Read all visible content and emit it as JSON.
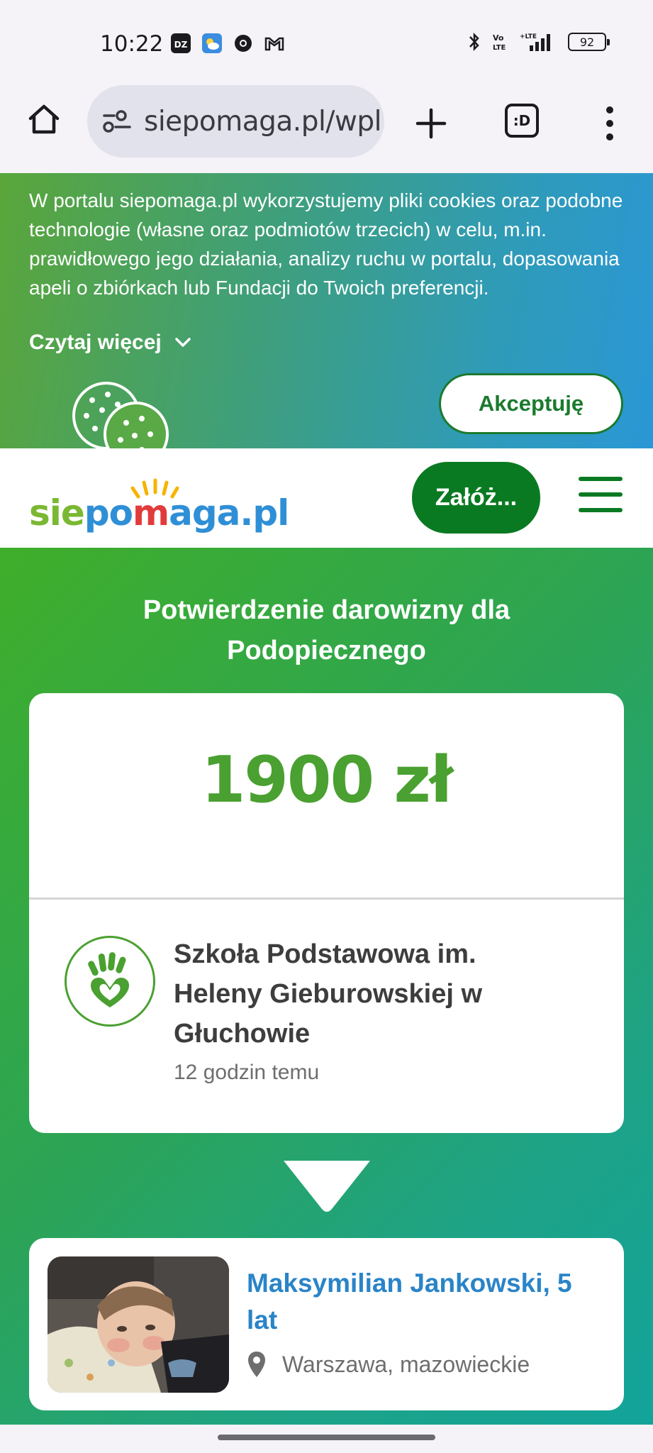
{
  "status_bar": {
    "time": "10:22",
    "notification_icons": [
      "dz-app-icon",
      "weather-icon",
      "chrome-icon",
      "gmail-icon"
    ],
    "status_icons": [
      "bluetooth-icon",
      "volte-icon",
      "signal-icon"
    ],
    "battery": "92"
  },
  "browser": {
    "url": "siepomaga.pl/wpl",
    "tabs_label": ":D"
  },
  "cookie_banner": {
    "text": "W portalu siepomaga.pl wykorzystujemy pliki cookies oraz podobne technologie (własne oraz podmiotów trzecich) w celu, m.in. prawidłowego jego działania, analizy ruchu w portalu, dopasowania apeli o zbiórkach lub Fundacji do Twoich preferencji.",
    "read_more": "Czytaj więcej",
    "accept_label": "Akceptuję"
  },
  "header": {
    "logo": {
      "sie": "sie",
      "po": "po",
      "m": "m",
      "aga": "aga",
      "pl": ".pl"
    },
    "found_label": "Załóż..."
  },
  "main": {
    "title": "Potwierdzenie darowizny dla Podopiecznego",
    "donation": {
      "amount": "1900 zł",
      "org_name": "Szkoła Podstawowa im. Heleny Gieburowskiej w Głuchowie",
      "time_ago": "12 godzin temu"
    },
    "beneficiary": {
      "name": "Maksymilian Jankowski, 5 lat",
      "location": "Warszawa, mazowieckie"
    }
  },
  "colors": {
    "brand_green": "#0a7a22",
    "amount_green": "#4aa030",
    "link_blue": "#2a84c8"
  }
}
